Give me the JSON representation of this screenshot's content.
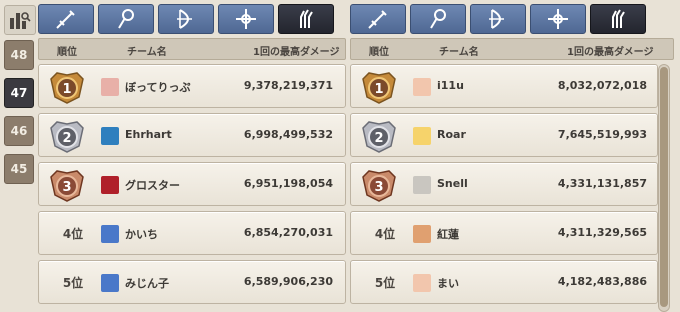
{
  "rounds": [
    "48",
    "47",
    "46",
    "45"
  ],
  "active_round_index": 1,
  "panels": [
    {
      "tabs": [
        "sword-icon",
        "staff-icon",
        "bow-icon",
        "cross-icon",
        "gauntlet-icon"
      ],
      "active_tab": 4,
      "header": {
        "rank": "順位",
        "team": "チーム名",
        "damage": "1回の最高ダメージ"
      },
      "rows": [
        {
          "rank": "1",
          "medal": "gold",
          "name": "ぼってりっぷ",
          "score": "9,378,219,371",
          "avatar_color": "#e8b0a8"
        },
        {
          "rank": "2",
          "medal": "silver",
          "name": "Ehrhart",
          "score": "6,998,499,532",
          "avatar_color": "#2f7fbe"
        },
        {
          "rank": "3",
          "medal": "bronze",
          "name": "グロスター",
          "score": "6,951,198,054",
          "avatar_color": "#b0202a"
        },
        {
          "rank": "4位",
          "medal": "",
          "name": "かいち",
          "score": "6,854,270,031",
          "avatar_color": "#4a78c9"
        },
        {
          "rank": "5位",
          "medal": "",
          "name": "みじん子",
          "score": "6,589,906,230",
          "avatar_color": "#4a78c9"
        }
      ]
    },
    {
      "tabs": [
        "sword-icon",
        "staff-icon",
        "bow-icon",
        "cross-icon",
        "gauntlet-icon"
      ],
      "active_tab": 4,
      "header": {
        "rank": "順位",
        "team": "チーム名",
        "damage": "1回の最高ダメージ"
      },
      "rows": [
        {
          "rank": "1",
          "medal": "gold",
          "name": "i11u",
          "score": "8,032,072,018",
          "avatar_color": "#f2c6ad"
        },
        {
          "rank": "2",
          "medal": "silver",
          "name": "Roar",
          "score": "7,645,519,993",
          "avatar_color": "#f6d36b"
        },
        {
          "rank": "3",
          "medal": "bronze",
          "name": "Snell",
          "score": "4,331,131,857",
          "avatar_color": "#c9c6c0"
        },
        {
          "rank": "4位",
          "medal": "",
          "name": "紅蓮",
          "score": "4,311,329,565",
          "avatar_color": "#e0a070"
        },
        {
          "rank": "5位",
          "medal": "",
          "name": "まい",
          "score": "4,182,483,886",
          "avatar_color": "#f2c6ad"
        }
      ]
    }
  ],
  "colors": {
    "gold": "#c58a3a",
    "silver": "#8d8f99",
    "bronze": "#8a4a36"
  }
}
